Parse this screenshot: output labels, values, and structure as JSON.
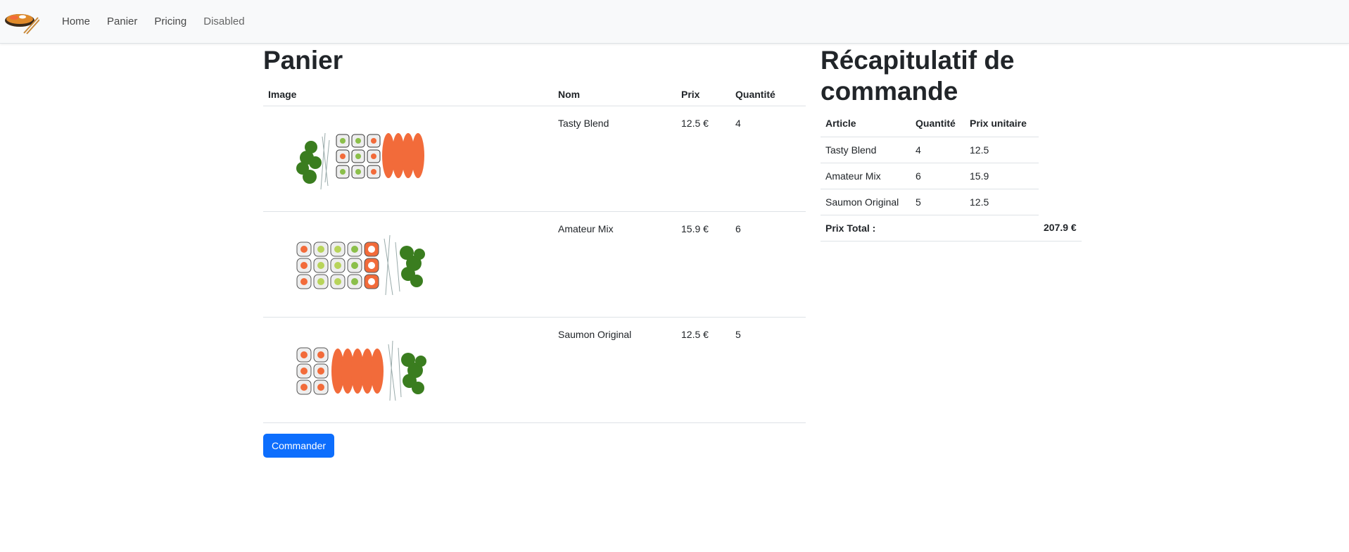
{
  "nav": {
    "items": [
      {
        "label": "Home"
      },
      {
        "label": "Panier"
      },
      {
        "label": "Pricing"
      },
      {
        "label": "Disabled"
      }
    ]
  },
  "cart": {
    "title": "Panier",
    "headers": {
      "image": "Image",
      "nom": "Nom",
      "prix": "Prix",
      "quantite": "Quantité"
    },
    "rows": [
      {
        "image_icon": "sushi-platter-tasty-blend",
        "nom": "Tasty Blend",
        "prix": "12.5 €",
        "quantite": "4"
      },
      {
        "image_icon": "sushi-platter-amateur-mix",
        "nom": "Amateur Mix",
        "prix": "15.9 €",
        "quantite": "6"
      },
      {
        "image_icon": "sushi-platter-saumon-original",
        "nom": "Saumon Original",
        "prix": "12.5 €",
        "quantite": "5"
      }
    ],
    "order_button": "Commander"
  },
  "recap": {
    "title": "Récapitulatif de commande",
    "headers": {
      "article": "Article",
      "quantite": "Quantité",
      "prix_unitaire": "Prix unitaire"
    },
    "rows": [
      {
        "article": "Tasty Blend",
        "quantite": "4",
        "prix_unitaire": "12.5"
      },
      {
        "article": "Amateur Mix",
        "quantite": "6",
        "prix_unitaire": "15.9"
      },
      {
        "article": "Saumon Original",
        "quantite": "5",
        "prix_unitaire": "12.5"
      }
    ],
    "total_label": "Prix Total :",
    "total_value": "207.9 €"
  },
  "colors": {
    "primary": "#0d6efd",
    "navbar_bg": "#f8f9fa",
    "salmon": "#f26b3a",
    "nori": "#3a7d1f"
  }
}
